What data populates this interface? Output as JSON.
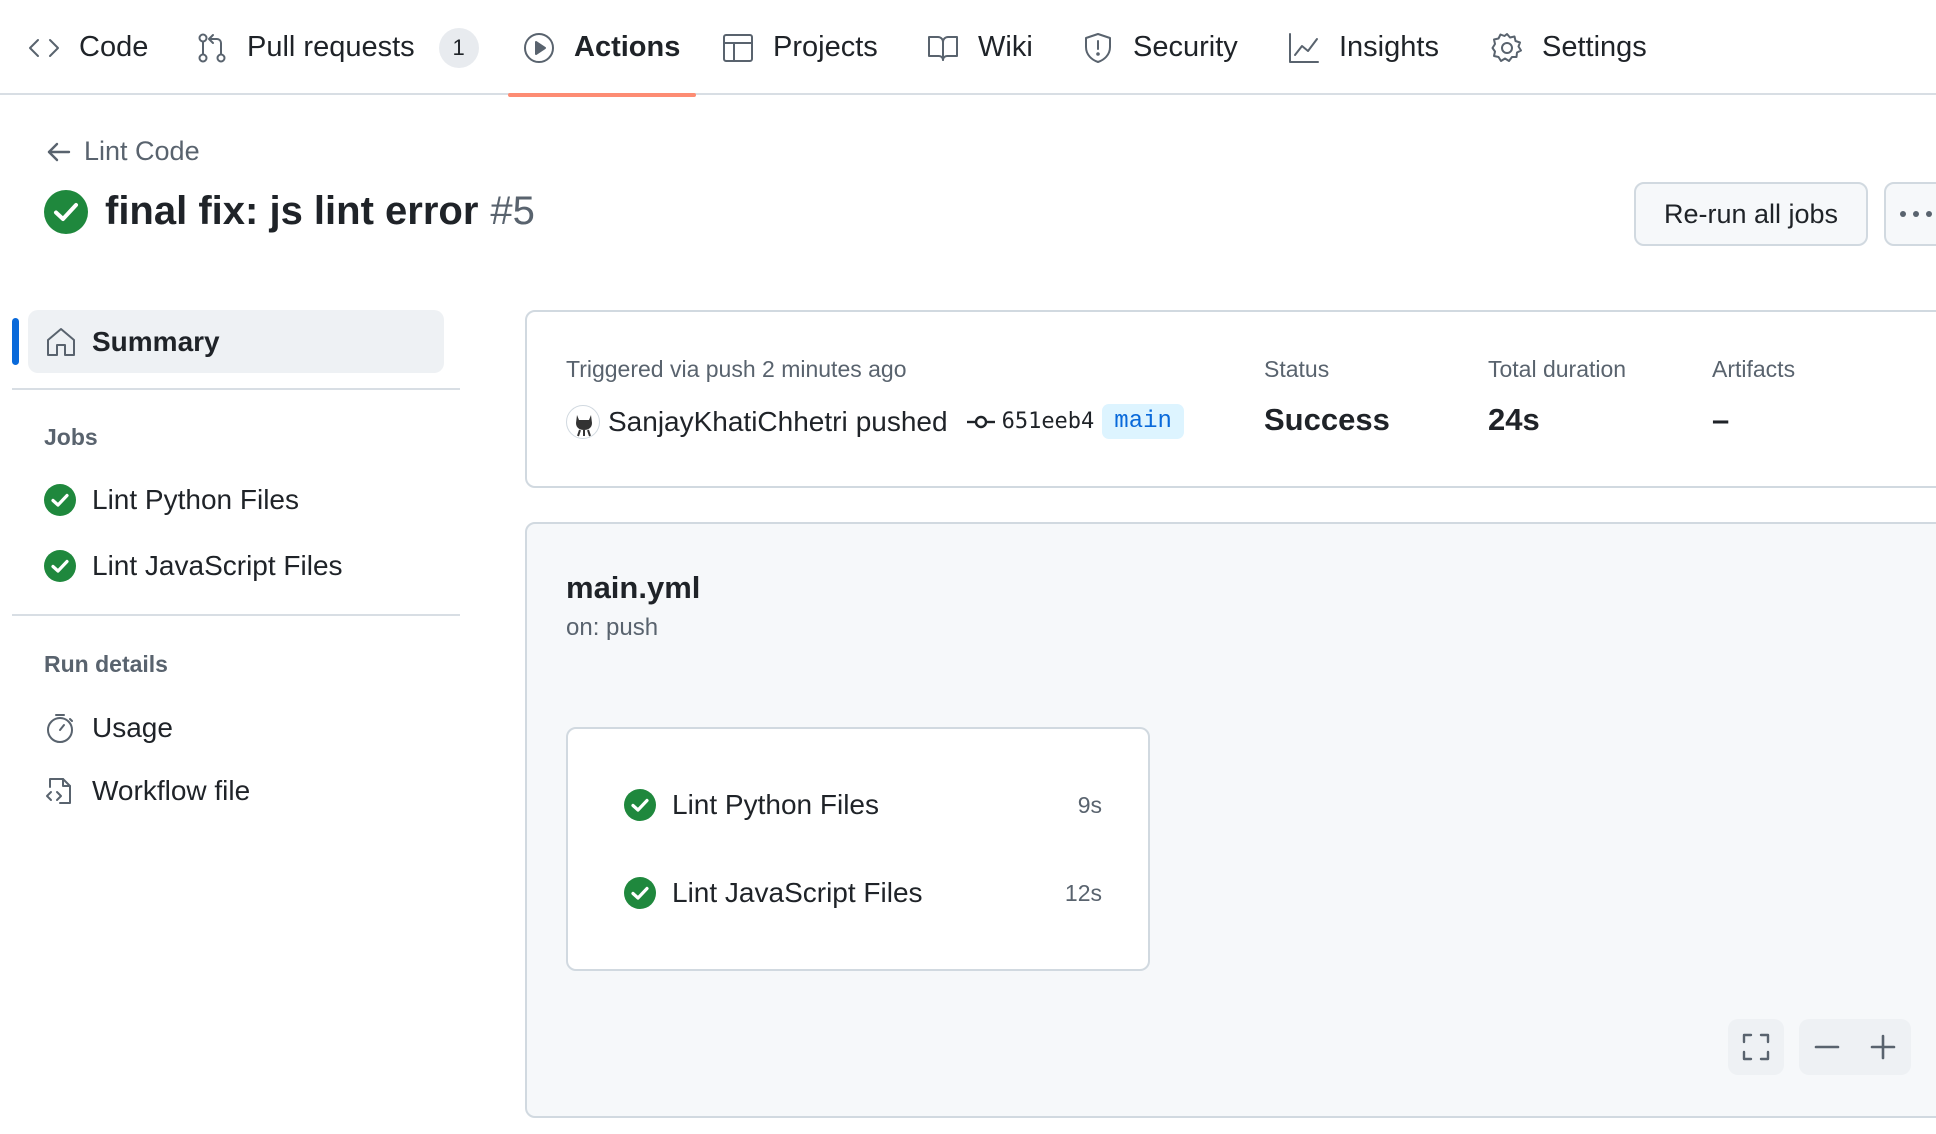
{
  "nav": {
    "tabs": [
      {
        "label": "Code",
        "icon": "code-icon"
      },
      {
        "label": "Pull requests",
        "icon": "git-pull-request-icon",
        "counter": "1"
      },
      {
        "label": "Actions",
        "icon": "play-icon",
        "active": true
      },
      {
        "label": "Projects",
        "icon": "table-icon"
      },
      {
        "label": "Wiki",
        "icon": "book-icon"
      },
      {
        "label": "Security",
        "icon": "shield-icon"
      },
      {
        "label": "Insights",
        "icon": "graph-icon"
      },
      {
        "label": "Settings",
        "icon": "gear-icon"
      }
    ],
    "active_color": "#fd8c73"
  },
  "header": {
    "back_label": "Lint Code",
    "run_title": "final fix: js lint error",
    "run_number": "#5",
    "status_icon": "check-circle-fill-icon",
    "rerun_label": "Re-run all jobs"
  },
  "sidebar": {
    "summary_label": "Summary",
    "jobs_heading": "Jobs",
    "jobs": [
      {
        "label": "Lint Python Files",
        "icon": "check-circle-fill-icon"
      },
      {
        "label": "Lint JavaScript Files",
        "icon": "check-circle-fill-icon"
      }
    ],
    "run_details_heading": "Run details",
    "details": [
      {
        "label": "Usage",
        "icon": "stopwatch-icon"
      },
      {
        "label": "Workflow file",
        "icon": "file-code-icon"
      }
    ]
  },
  "summary": {
    "trigger_text": "Triggered via push 2 minutes ago",
    "actor": "SanjayKhatiChhetri",
    "action": "pushed",
    "commit_sha": "651eeb4",
    "branch": "main",
    "status_label": "Status",
    "status_value": "Success",
    "duration_label": "Total duration",
    "duration_value": "24s",
    "artifacts_label": "Artifacts",
    "artifacts_value": "–"
  },
  "workflow": {
    "file": "main.yml",
    "trigger": "on: push",
    "jobs": [
      {
        "label": "Lint Python Files",
        "duration": "9s"
      },
      {
        "label": "Lint JavaScript Files",
        "duration": "12s"
      }
    ]
  },
  "colors": {
    "success": "#1f883d",
    "link": "#0969da",
    "muted": "#59636e"
  }
}
